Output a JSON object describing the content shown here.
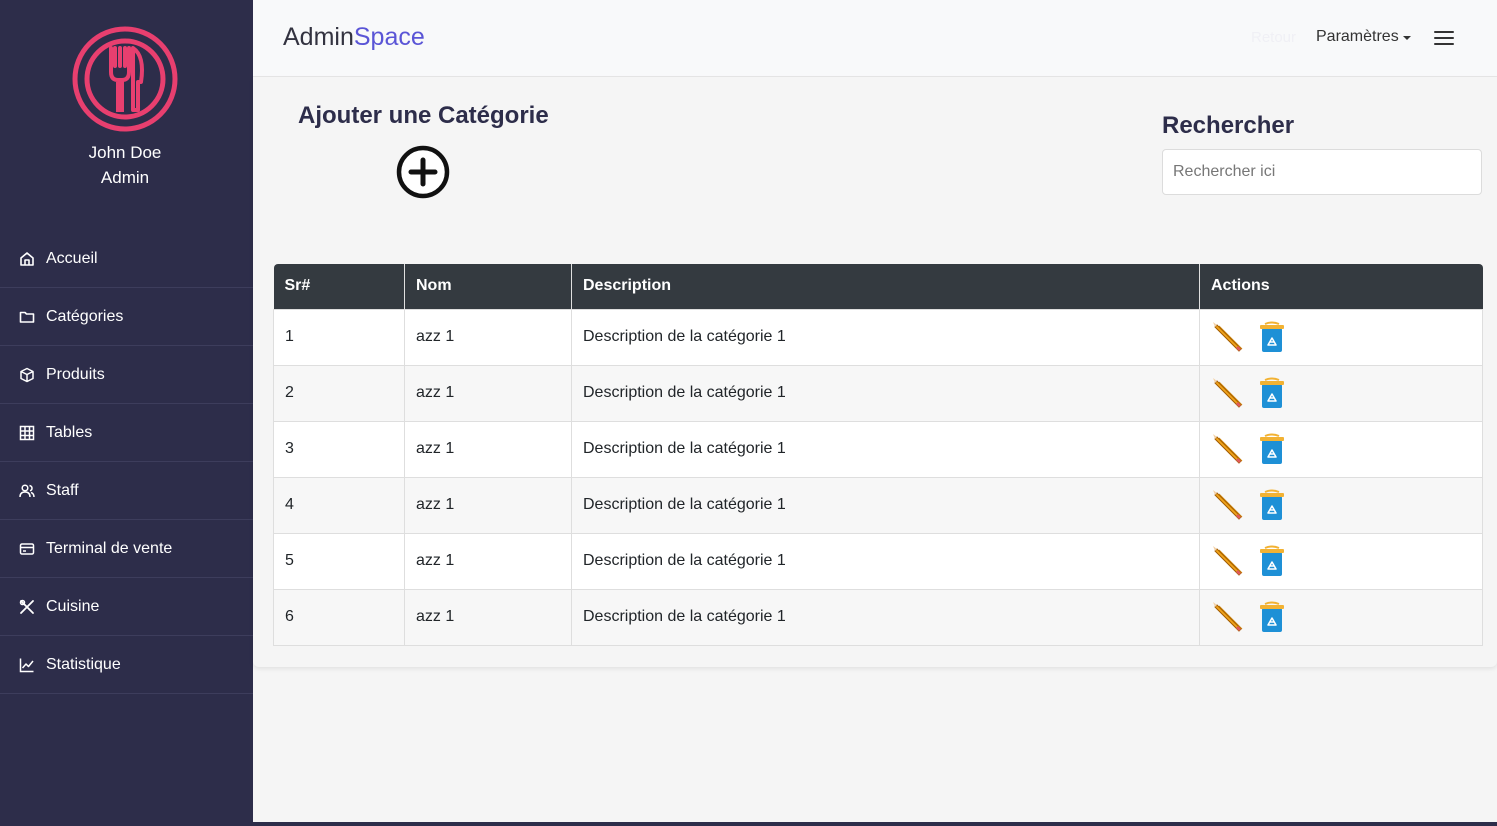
{
  "sidebar": {
    "user_name": "John Doe",
    "user_role": "Admin",
    "items": [
      {
        "label": "Accueil",
        "icon": "home-icon"
      },
      {
        "label": "Catégories",
        "icon": "folder-icon"
      },
      {
        "label": "Produits",
        "icon": "box-icon"
      },
      {
        "label": "Tables",
        "icon": "grid-icon"
      },
      {
        "label": "Staff",
        "icon": "users-icon"
      },
      {
        "label": "Terminal de vente",
        "icon": "card-icon"
      },
      {
        "label": "Cuisine",
        "icon": "tools-icon"
      },
      {
        "label": "Statistique",
        "icon": "chart-icon"
      }
    ]
  },
  "header": {
    "title_main": "Admin",
    "title_accent": "Space",
    "faint_link": "Retour",
    "settings_label": "Paramètres"
  },
  "add_section": {
    "title": "Ajouter une Catégorie"
  },
  "search": {
    "title": "Rechercher",
    "placeholder": "Rechercher ici",
    "value": ""
  },
  "table": {
    "columns": [
      "Sr#",
      "Nom",
      "Description",
      "Actions"
    ],
    "rows": [
      {
        "sr": "1",
        "nom": "azz 1",
        "description": "Description de la catégorie 1"
      },
      {
        "sr": "2",
        "nom": "azz 1",
        "description": "Description de la catégorie 1"
      },
      {
        "sr": "3",
        "nom": "azz 1",
        "description": "Description de la catégorie 1"
      },
      {
        "sr": "4",
        "nom": "azz 1",
        "description": "Description de la catégorie 1"
      },
      {
        "sr": "5",
        "nom": "azz 1",
        "description": "Description de la catégorie 1"
      },
      {
        "sr": "6",
        "nom": "azz 1",
        "description": "Description de la catégorie 1"
      }
    ]
  },
  "colors": {
    "sidebar_bg": "#2d2d4a",
    "accent": "#5a55d6",
    "logo": "#e83f6f",
    "table_header": "#343a40"
  }
}
